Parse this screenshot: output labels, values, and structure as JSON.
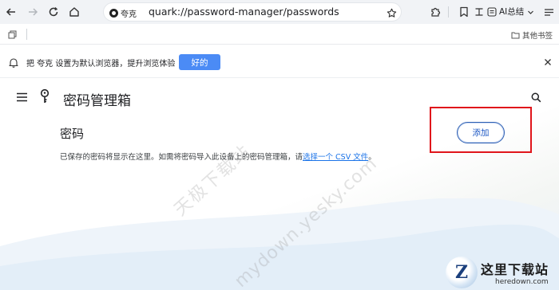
{
  "toolbar": {
    "engine_name": "夸克",
    "url": "quark://password-manager/passwords",
    "ai_label": "AI总结"
  },
  "bookmarks": {
    "other_bookmarks": "其他书签"
  },
  "infobar": {
    "message": "把 夸克 设置为默认浏览器，提升浏览体验",
    "ok_label": "好的"
  },
  "page": {
    "title": "密码管理箱",
    "section_title": "密码",
    "description_prefix": "已保存的密码将显示在这里。如需将密码导入此设备上的密码管理箱，请",
    "description_link": "选择一个 CSV 文件",
    "description_suffix": "。",
    "add_label": "添加"
  },
  "watermark": {
    "line1": "天极下载站",
    "line2": "mydown.yesky.com"
  },
  "brand": {
    "logo_letter": "Z",
    "name_cn": "这里下载站",
    "name_en": "heredown.com"
  },
  "colors": {
    "accent": "#4b8bf5",
    "link": "#1a73e8",
    "highlight_box": "#e0151b"
  }
}
